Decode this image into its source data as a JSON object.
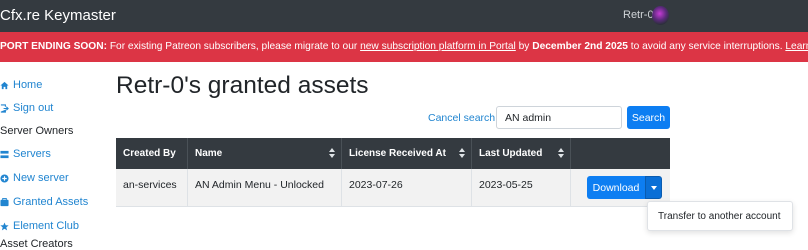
{
  "topbar": {
    "brand": "Cfx.re Keymaster",
    "user": "Retr-0"
  },
  "alert": {
    "prefix": "PORT ENDING SOON:",
    "text1": " For existing Patreon subscribers, please migrate to our ",
    "link1": "new subscription platform in Portal",
    "text2": " by ",
    "deadline": "December 2nd 2025",
    "text3": " to avoid any service interruptions. ",
    "link2": "Learn more",
    "text4": "."
  },
  "sidebar": {
    "home": "Home",
    "signout": "Sign out",
    "server_owners": "Server Owners",
    "servers": "Servers",
    "new_server": "New server",
    "granted_assets": "Granted Assets",
    "element_club": "Element Club",
    "asset_creators": "Asset Creators"
  },
  "page": {
    "title": "Retr-0's granted assets"
  },
  "search": {
    "cancel": "Cancel search",
    "value": "AN admin",
    "button": "Search"
  },
  "table": {
    "headers": [
      "Created By",
      "Name",
      "License Received At",
      "Last Updated",
      ""
    ],
    "rows": [
      {
        "created_by": "an-services",
        "name": "AN Admin Menu - Unlocked",
        "license_received": "2023-07-26",
        "last_updated": "2023-05-25"
      }
    ]
  },
  "download": {
    "label": "Download",
    "menu_item": "Transfer to another account"
  },
  "colors": {
    "primary": "#0d7ef2",
    "alert": "#dc3545",
    "dark": "#343a40",
    "link": "#2185d0"
  },
  "icons": {
    "home": "home-icon",
    "signout": "sign-out-icon",
    "servers": "servers-icon",
    "new_server": "plus-circle-icon",
    "granted_assets": "assets-icon",
    "element_club": "star-icon"
  }
}
